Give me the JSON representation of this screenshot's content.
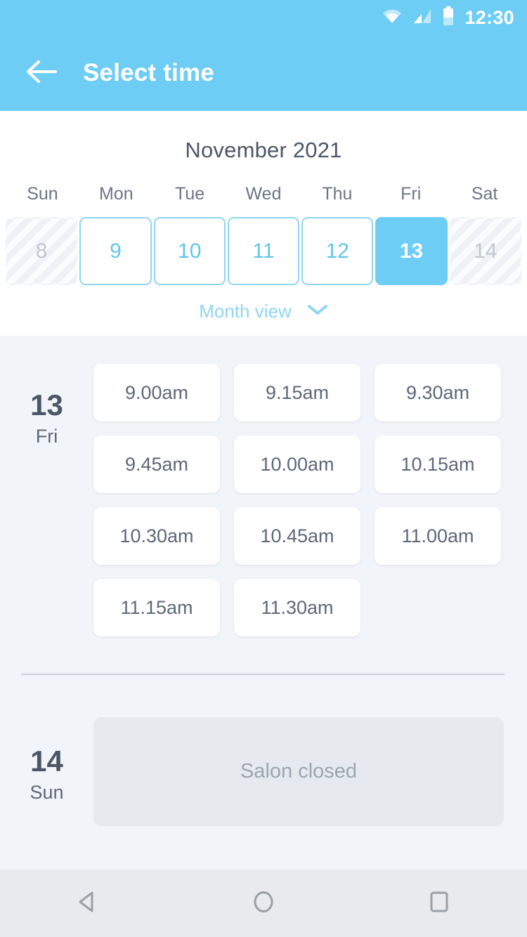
{
  "status_bar": {
    "time": "12:30",
    "icons": [
      "wifi-icon",
      "signal-icon",
      "battery-icon"
    ]
  },
  "app_bar": {
    "back_icon": "back-arrow-icon",
    "title": "Select time"
  },
  "calendar": {
    "month_title": "November 2021",
    "weekdays": [
      "Sun",
      "Mon",
      "Tue",
      "Wed",
      "Thu",
      "Fri",
      "Sat"
    ],
    "days": [
      {
        "number": "8",
        "state": "disabled"
      },
      {
        "number": "9",
        "state": "available"
      },
      {
        "number": "10",
        "state": "available"
      },
      {
        "number": "11",
        "state": "available"
      },
      {
        "number": "12",
        "state": "available"
      },
      {
        "number": "13",
        "state": "selected"
      },
      {
        "number": "14",
        "state": "disabled"
      }
    ],
    "month_view_label": "Month view",
    "month_view_icon": "chevron-down-icon"
  },
  "schedule": [
    {
      "day_number": "13",
      "day_name": "Fri",
      "slots": [
        "9.00am",
        "9.15am",
        "9.30am",
        "9.45am",
        "10.00am",
        "10.15am",
        "10.30am",
        "10.45am",
        "11.00am",
        "11.15am",
        "11.30am"
      ]
    },
    {
      "day_number": "14",
      "day_name": "Sun",
      "closed_message": "Salon closed"
    }
  ],
  "nav_bar": {
    "back": "nav-back-icon",
    "home": "nav-home-icon",
    "recents": "nav-recents-icon"
  },
  "colors": {
    "accent": "#6ecdf5",
    "accent_light": "#8ed6f3",
    "text_dark": "#4b5767",
    "text_muted": "#5c6879",
    "content_bg": "#f1f4f8",
    "closed_bg": "#e6eaee"
  }
}
